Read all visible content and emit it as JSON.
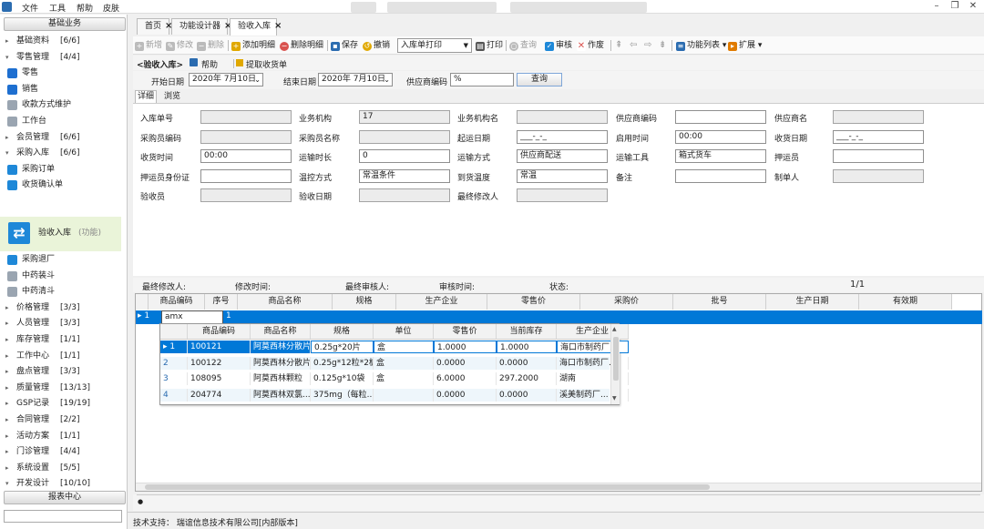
{
  "menu": [
    "文件",
    "工具",
    "帮助",
    "皮肤"
  ],
  "sidebar": {
    "header": "基础业务",
    "footer_btn": "报表中心",
    "items": [
      {
        "type": "group",
        "label": "基础资料",
        "count": "[6/6]"
      },
      {
        "type": "group",
        "label": "零售管理",
        "count": "[4/4]",
        "expanded": true
      },
      {
        "type": "leaf",
        "label": "零售",
        "icon": "blue-doc-icon"
      },
      {
        "type": "leaf",
        "label": "销售",
        "icon": "blue-doc-icon"
      },
      {
        "type": "leaf",
        "label": "收款方式维护",
        "icon": "list-icon"
      },
      {
        "type": "leaf",
        "label": "工作台",
        "icon": "list-icon"
      },
      {
        "type": "group",
        "label": "会员管理",
        "count": "[6/6]"
      },
      {
        "type": "group",
        "label": "采购入库",
        "count": "[6/6]",
        "expanded": true
      },
      {
        "type": "leaf",
        "label": "采购订单",
        "icon": "order-icon"
      },
      {
        "type": "leaf",
        "label": "收货确认单",
        "icon": "confirm-icon"
      }
    ],
    "selected": {
      "label": "验收入库",
      "sub": "(功能)"
    },
    "items2": [
      {
        "type": "leaf",
        "label": "采购退厂",
        "icon": "return-icon"
      },
      {
        "type": "leaf",
        "label": "中药装斗",
        "icon": "list-icon"
      },
      {
        "type": "leaf",
        "label": "中药清斗",
        "icon": "list-icon"
      },
      {
        "type": "group",
        "label": "价格管理",
        "count": "[3/3]"
      },
      {
        "type": "group",
        "label": "人员管理",
        "count": "[3/3]"
      },
      {
        "type": "group",
        "label": "库存管理",
        "count": "[1/1]"
      },
      {
        "type": "group",
        "label": "工作中心",
        "count": "[1/1]"
      },
      {
        "type": "group",
        "label": "盘点管理",
        "count": "[3/3]"
      },
      {
        "type": "group",
        "label": "质量管理",
        "count": "[13/13]"
      },
      {
        "type": "group",
        "label": "GSP记录",
        "count": "[19/19]"
      },
      {
        "type": "group",
        "label": "合同管理",
        "count": "[2/2]"
      },
      {
        "type": "group",
        "label": "活动方案",
        "count": "[1/1]"
      },
      {
        "type": "group",
        "label": "门诊管理",
        "count": "[4/4]"
      },
      {
        "type": "group",
        "label": "系统设置",
        "count": "[5/5]"
      },
      {
        "type": "group",
        "label": "开发设计",
        "count": "[10/10]",
        "expanded": true
      }
    ]
  },
  "tabs": [
    {
      "label": "首页"
    },
    {
      "label": "功能设计器"
    },
    {
      "label": "验收入库",
      "active": true
    }
  ],
  "toolbar": {
    "new": "新增",
    "edit": "修改",
    "delete": "删除",
    "add_detail": "添加明细",
    "del_detail": "删除明细",
    "save": "保存",
    "cancel": "撤销",
    "print_select": "入库单打印",
    "print": "打印",
    "query": "查询",
    "audit": "审核",
    "void": "作废",
    "func_list": "功能列表",
    "extend": "扩展"
  },
  "subbar": {
    "title": "<验收入库>",
    "help": "帮助",
    "fetch": "提取收货单"
  },
  "filter": {
    "start_label": "开始日期",
    "start_value": "2020年 7月10日",
    "end_label": "结束日期",
    "end_value": "2020年 7月10日",
    "supplier_label": "供应商编码",
    "supplier_value": "%",
    "query_btn": "查询"
  },
  "formtabs": [
    "详细",
    "浏览"
  ],
  "form": {
    "rows": [
      [
        {
          "label": "入库单号",
          "value": "",
          "gray": true
        },
        {
          "label": "业务机构",
          "value": "17",
          "gray": true
        },
        {
          "label": "业务机构名",
          "value": "",
          "gray": true
        },
        {
          "label": "供应商编码",
          "value": "",
          "gray": false
        },
        {
          "label": "供应商名",
          "value": "",
          "gray": true
        }
      ],
      [
        {
          "label": "采购员编码",
          "value": "",
          "gray": true
        },
        {
          "label": "采购员名称",
          "value": "",
          "gray": true
        },
        {
          "label": "起运日期",
          "value": "___-_-_",
          "gray": false
        },
        {
          "label": "启用时间",
          "value": "00:00",
          "gray": false
        },
        {
          "label": "收货日期",
          "value": "___-_-_",
          "gray": false
        }
      ],
      [
        {
          "label": "收货时间",
          "value": "00:00",
          "gray": false
        },
        {
          "label": "运输时长",
          "value": "0",
          "gray": false
        },
        {
          "label": "运输方式",
          "value": "供应商配送",
          "gray": false
        },
        {
          "label": "运输工具",
          "value": "箱式货车",
          "gray": false
        },
        {
          "label": "押运员",
          "value": "",
          "gray": false
        }
      ],
      [
        {
          "label": "押运员身份证",
          "value": "",
          "gray": false
        },
        {
          "label": "温控方式",
          "value": "常温条件",
          "gray": false
        },
        {
          "label": "到货温度",
          "value": "常温",
          "gray": false
        },
        {
          "label": "备注",
          "value": "",
          "gray": false
        },
        {
          "label": "制单人",
          "value": "",
          "gray": true
        }
      ],
      [
        {
          "label": "验收员",
          "value": "",
          "gray": true
        },
        {
          "label": "验收日期",
          "value": "",
          "gray": true
        },
        {
          "label": "最终修改人",
          "value": "",
          "gray": true
        }
      ]
    ]
  },
  "status": {
    "last_modifier": "最终修改人:",
    "modify_time": "修改时间:",
    "final_auditor": "最终审核人:",
    "audit_time": "审核时间:",
    "state": "状态:",
    "page": "1/1"
  },
  "grid": {
    "columns": [
      "商品编码",
      "序号",
      "商品名称",
      "规格",
      "生产企业",
      "零售价",
      "采购价",
      "批号",
      "生产日期",
      "有效期"
    ],
    "row": {
      "indicator": "▸ 1",
      "code": "amx",
      "seq": "1"
    }
  },
  "popup": {
    "columns": [
      "商品编码",
      "商品名称",
      "规格",
      "单位",
      "零售价",
      "当前库存",
      "生产企业"
    ],
    "rows": [
      {
        "idx": "▸ 1",
        "code": "100121",
        "name": "阿莫西林分散片",
        "spec": "0.25g*20片",
        "unit": "盒",
        "retail": "1.0000",
        "stock": "1.0000",
        "maker": "海口市制药厂..."
      },
      {
        "idx": "2",
        "code": "100122",
        "name": "阿莫西林分散片",
        "spec": "0.25g*12粒*2板",
        "unit": "盒",
        "retail": "0.0000",
        "stock": "0.0000",
        "maker": "海口市制药厂..."
      },
      {
        "idx": "3",
        "code": "108095",
        "name": "阿莫西林颗粒",
        "spec": "0.125g*10袋",
        "unit": "盒",
        "retail": "6.0000",
        "stock": "297.2000",
        "maker": "湖南"
      },
      {
        "idx": "4",
        "code": "204774",
        "name": "阿莫西林双氯...",
        "spec": "375mg（每粒...",
        "unit": "",
        "retail": "0.0000",
        "stock": "0.0000",
        "maker": "溪美制药厂..."
      }
    ]
  },
  "bottom_marker": "●",
  "footer": "技术支持：    瑞谊信息技术有限公司[内部版本]",
  "colors": {
    "selection": "#0078d7",
    "accent_blue": "#1e88d8",
    "selected_nav_bg": "#eaf4d9"
  }
}
